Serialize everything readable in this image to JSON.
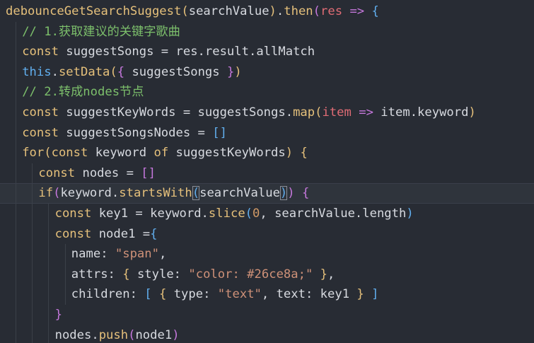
{
  "lines": [
    {
      "indent": 0,
      "tokens": [
        {
          "t": "debounceGetSearchSuggest",
          "c": "t-yellow"
        },
        {
          "t": "(",
          "c": "t-br1"
        },
        {
          "t": "searchValue",
          "c": "t-plain"
        },
        {
          "t": ")",
          "c": "t-br1"
        },
        {
          "t": ".",
          "c": "t-plain"
        },
        {
          "t": "then",
          "c": "t-then"
        },
        {
          "t": "(",
          "c": "t-br2"
        },
        {
          "t": "res",
          "c": "t-param"
        },
        {
          "t": " ",
          "c": "t-plain"
        },
        {
          "t": "=>",
          "c": "t-arrow"
        },
        {
          "t": " ",
          "c": "t-plain"
        },
        {
          "t": "{",
          "c": "t-br3"
        }
      ]
    },
    {
      "indent": 1,
      "tokens": [
        {
          "t": "// 1.获取建议的关键字歌曲",
          "c": "t-cm"
        }
      ]
    },
    {
      "indent": 1,
      "tokens": [
        {
          "t": "const",
          "c": "t-kw"
        },
        {
          "t": " suggestSongs = res.result.allMatch",
          "c": "t-plain"
        }
      ]
    },
    {
      "indent": 1,
      "tokens": [
        {
          "t": "this",
          "c": "t-this"
        },
        {
          "t": ".",
          "c": "t-plain"
        },
        {
          "t": "setData",
          "c": "t-method"
        },
        {
          "t": "(",
          "c": "t-br1"
        },
        {
          "t": "{",
          "c": "t-br2"
        },
        {
          "t": " suggestSongs ",
          "c": "t-plain"
        },
        {
          "t": "}",
          "c": "t-br2"
        },
        {
          "t": ")",
          "c": "t-br1"
        }
      ]
    },
    {
      "indent": 1,
      "tokens": [
        {
          "t": "// 2.转成nodes节点",
          "c": "t-cm"
        }
      ]
    },
    {
      "indent": 1,
      "tokens": [
        {
          "t": "const",
          "c": "t-kw"
        },
        {
          "t": " suggestKeyWords = suggestSongs.",
          "c": "t-plain"
        },
        {
          "t": "map",
          "c": "t-method"
        },
        {
          "t": "(",
          "c": "t-br1"
        },
        {
          "t": "item",
          "c": "t-param"
        },
        {
          "t": " ",
          "c": "t-plain"
        },
        {
          "t": "=>",
          "c": "t-arrow"
        },
        {
          "t": " item.keyword",
          "c": "t-plain"
        },
        {
          "t": ")",
          "c": "t-br1"
        }
      ]
    },
    {
      "indent": 1,
      "tokens": [
        {
          "t": "const",
          "c": "t-kw"
        },
        {
          "t": " suggestSongsNodes = ",
          "c": "t-plain"
        },
        {
          "t": "[]",
          "c": "t-br3"
        }
      ]
    },
    {
      "indent": 1,
      "tokens": [
        {
          "t": "for",
          "c": "t-kw"
        },
        {
          "t": "(",
          "c": "t-br1"
        },
        {
          "t": "const",
          "c": "t-kw"
        },
        {
          "t": " keyword ",
          "c": "t-plain"
        },
        {
          "t": "of",
          "c": "t-kw"
        },
        {
          "t": " suggestKeyWords",
          "c": "t-plain"
        },
        {
          "t": ")",
          "c": "t-br1"
        },
        {
          "t": " ",
          "c": "t-plain"
        },
        {
          "t": "{",
          "c": "t-br1"
        }
      ]
    },
    {
      "indent": 2,
      "tokens": [
        {
          "t": "const",
          "c": "t-kw"
        },
        {
          "t": " nodes = ",
          "c": "t-plain"
        },
        {
          "t": "[]",
          "c": "t-br2"
        }
      ]
    },
    {
      "indent": 2,
      "current": true,
      "tokens": [
        {
          "t": "if",
          "c": "t-kw"
        },
        {
          "t": "(",
          "c": "t-br2"
        },
        {
          "t": "keyword.",
          "c": "t-plain"
        },
        {
          "t": "startsWith",
          "c": "t-method"
        },
        {
          "t": "(",
          "c": "t-br3 match-box"
        },
        {
          "t": "searchValue",
          "c": "t-plain"
        },
        {
          "t": ")",
          "c": "t-br3 match-box"
        },
        {
          "t": ")",
          "c": "t-br2"
        },
        {
          "t": " ",
          "c": "t-plain"
        },
        {
          "t": "{",
          "c": "t-br2"
        }
      ]
    },
    {
      "indent": 3,
      "tokens": [
        {
          "t": "const",
          "c": "t-kw"
        },
        {
          "t": " key1 = keyword.",
          "c": "t-plain"
        },
        {
          "t": "slice",
          "c": "t-method"
        },
        {
          "t": "(",
          "c": "t-br3"
        },
        {
          "t": "0",
          "c": "t-num"
        },
        {
          "t": ", searchValue.length",
          "c": "t-plain"
        },
        {
          "t": ")",
          "c": "t-br3"
        }
      ]
    },
    {
      "indent": 3,
      "tokens": [
        {
          "t": "const",
          "c": "t-kw"
        },
        {
          "t": " node1 =",
          "c": "t-plain"
        },
        {
          "t": "{",
          "c": "t-br3"
        }
      ]
    },
    {
      "indent": 4,
      "tokens": [
        {
          "t": "name: ",
          "c": "t-plain"
        },
        {
          "t": "\"span\"",
          "c": "t-str"
        },
        {
          "t": ",",
          "c": "t-plain"
        }
      ]
    },
    {
      "indent": 4,
      "tokens": [
        {
          "t": "attrs: ",
          "c": "t-plain"
        },
        {
          "t": "{",
          "c": "t-br1"
        },
        {
          "t": " style: ",
          "c": "t-plain"
        },
        {
          "t": "\"color: #26ce8a;\"",
          "c": "t-str"
        },
        {
          "t": " ",
          "c": "t-plain"
        },
        {
          "t": "}",
          "c": "t-br1"
        },
        {
          "t": ",",
          "c": "t-plain"
        }
      ]
    },
    {
      "indent": 4,
      "tokens": [
        {
          "t": "children: ",
          "c": "t-plain"
        },
        {
          "t": "[",
          "c": "t-br3"
        },
        {
          "t": " ",
          "c": "t-plain"
        },
        {
          "t": "{",
          "c": "t-br1"
        },
        {
          "t": " type: ",
          "c": "t-plain"
        },
        {
          "t": "\"text\"",
          "c": "t-str"
        },
        {
          "t": ", text: key1 ",
          "c": "t-plain"
        },
        {
          "t": "}",
          "c": "t-br1"
        },
        {
          "t": " ",
          "c": "t-plain"
        },
        {
          "t": "]",
          "c": "t-br3"
        }
      ]
    },
    {
      "indent": 3,
      "tokens": [
        {
          "t": "}",
          "c": "t-br2"
        }
      ]
    },
    {
      "indent": 3,
      "tokens": [
        {
          "t": "nodes.",
          "c": "t-plain"
        },
        {
          "t": "push",
          "c": "t-method"
        },
        {
          "t": "(",
          "c": "t-br2"
        },
        {
          "t": "node1",
          "c": "t-plain"
        },
        {
          "t": ")",
          "c": "t-br2"
        }
      ]
    }
  ]
}
